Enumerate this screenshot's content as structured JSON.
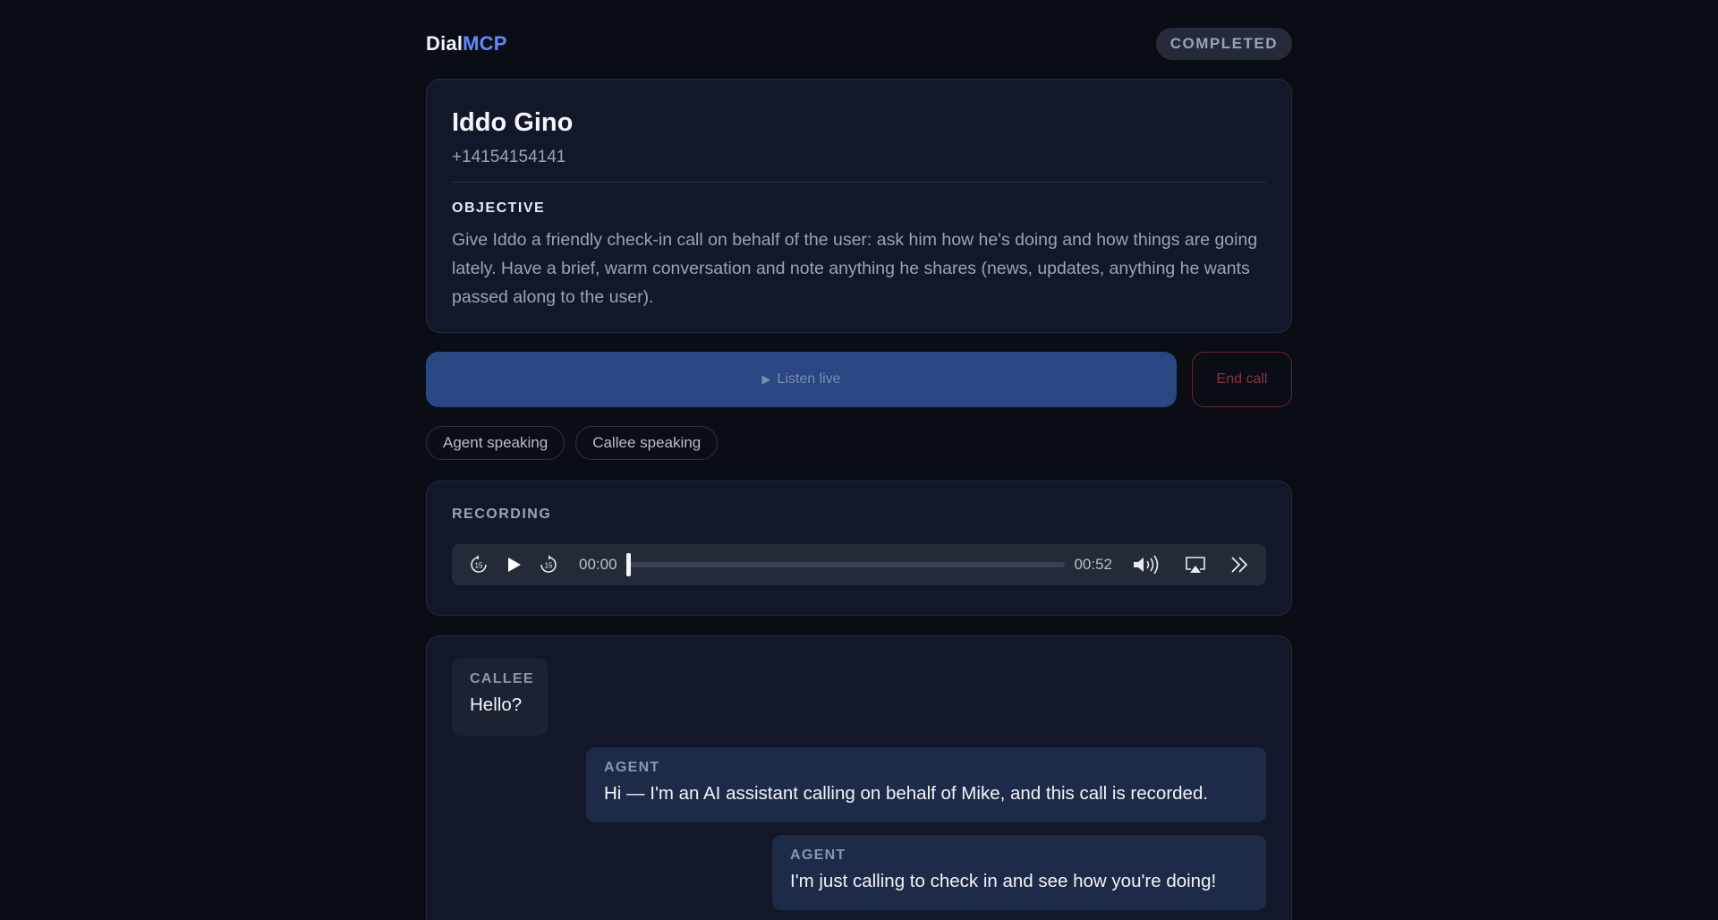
{
  "brand": {
    "part1": "Dial",
    "part2": "MCP",
    "accent_color": "#5b8cff"
  },
  "status": {
    "label": "COMPLETED"
  },
  "contact": {
    "name": "Iddo Gino",
    "phone": "+14154154141",
    "objective_label": "OBJECTIVE",
    "objective_text": "Give Iddo a friendly check-in call on behalf of the user: ask him how he's doing and how things are going lately. Have a brief, warm conversation and note anything he shares (news, updates, anything he wants passed along to the user)."
  },
  "actions": {
    "listen_icon": "play-triangle",
    "listen_label": "Listen live",
    "end_label": "End call"
  },
  "speaking_chips": [
    "Agent speaking",
    "Callee speaking"
  ],
  "recording": {
    "label": "RECORDING",
    "current_time": "00:00",
    "duration": "00:52",
    "progress": 0,
    "controls": [
      "skip-back-15-icon",
      "play-icon",
      "skip-forward-15-icon",
      "volume-icon",
      "airplay-icon",
      "more-icon"
    ]
  },
  "transcript": [
    {
      "speaker": "CALLEE",
      "text": "Hello?"
    },
    {
      "speaker": "AGENT",
      "text": "Hi — I'm an AI assistant calling on behalf of Mike, and this call is recorded."
    },
    {
      "speaker": "AGENT",
      "text": "I'm just calling to check in and see how you're doing!"
    }
  ],
  "colors": {
    "background": "#0a0d14",
    "card": "#121829",
    "listen_button": "#2a4783",
    "end_button_border": "#6a2533",
    "agent_bubble": "#1d2a48",
    "callee_bubble": "#1c2232"
  }
}
